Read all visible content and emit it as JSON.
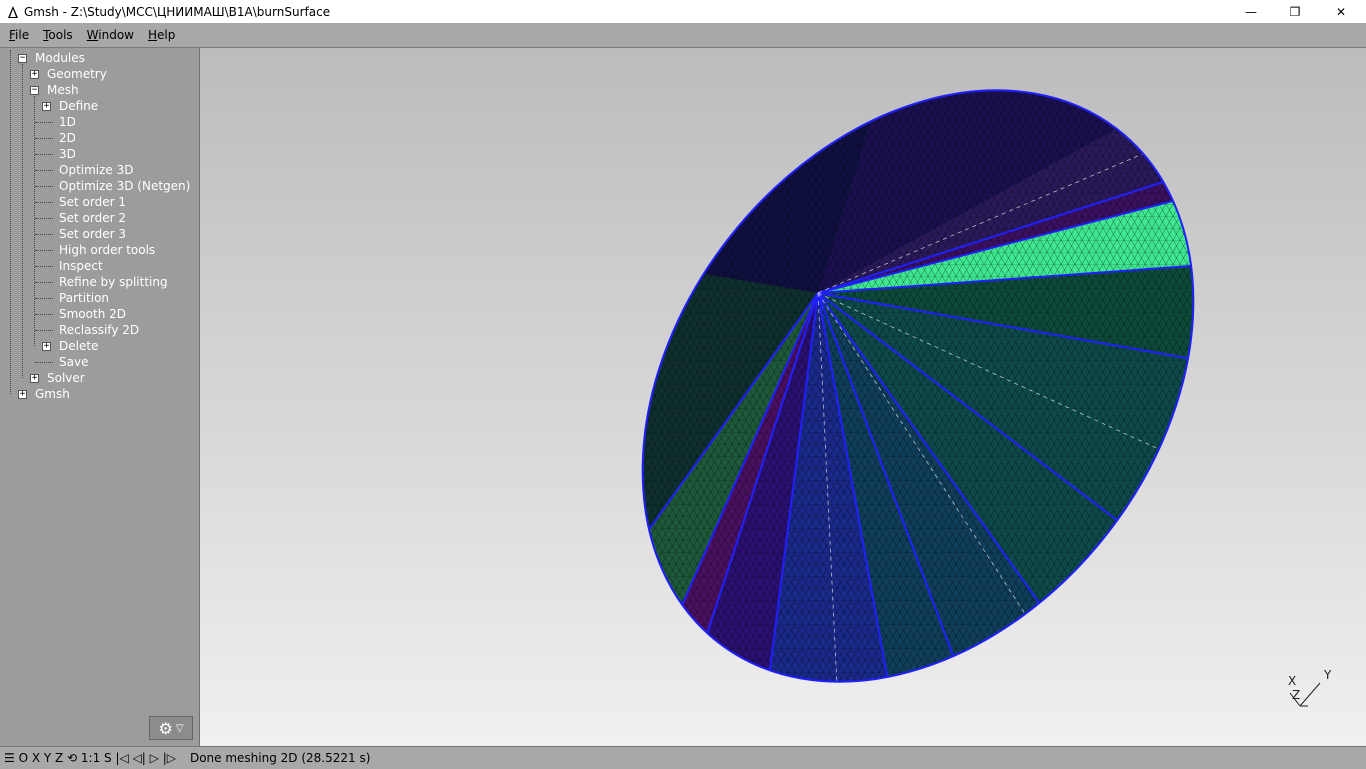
{
  "window": {
    "title": "Gmsh - Z:\\Study\\MCC\\ЦНИИМАШ\\B1A\\burnSurface",
    "minimize_glyph": "—",
    "maximize_glyph": "❐",
    "close_glyph": "✕"
  },
  "menu": {
    "file": {
      "hotkey": "F",
      "rest": "ile"
    },
    "tools": {
      "hotkey": "T",
      "rest": "ools"
    },
    "window": {
      "hotkey": "W",
      "rest": "indow"
    },
    "help": {
      "hotkey": "H",
      "rest": "elp"
    }
  },
  "tree": {
    "modules": "Modules",
    "geometry": "Geometry",
    "mesh": "Mesh",
    "define": "Define",
    "m1d": "1D",
    "m2d": "2D",
    "m3d": "3D",
    "optimize3d": "Optimize 3D",
    "optimize3d_netgen": "Optimize 3D (Netgen)",
    "order1": "Set order 1",
    "order2": "Set order 2",
    "order3": "Set order 3",
    "high_order": "High order tools",
    "inspect": "Inspect",
    "refine": "Refine by splitting",
    "partition": "Partition",
    "smooth2d": "Smooth 2D",
    "reclassify2d": "Reclassify 2D",
    "delete": "Delete",
    "save": "Save",
    "solver": "Solver",
    "gmsh": "Gmsh"
  },
  "status": {
    "buttons": "☰ O X Y Z ⟲ 1:1 S |◁ ◁| ▷ |▷",
    "message": "Done meshing 2D (28.5221 s)"
  },
  "axes": {
    "x": "X",
    "y": "Y",
    "z": "Z"
  },
  "colors": {
    "tree_bg": "#9c9c9c",
    "mesh_edge": "#2020ff",
    "mesh_green": "#3fe890",
    "mesh_teal": "#0e4a4a",
    "mesh_purple": "#3a0a60"
  }
}
